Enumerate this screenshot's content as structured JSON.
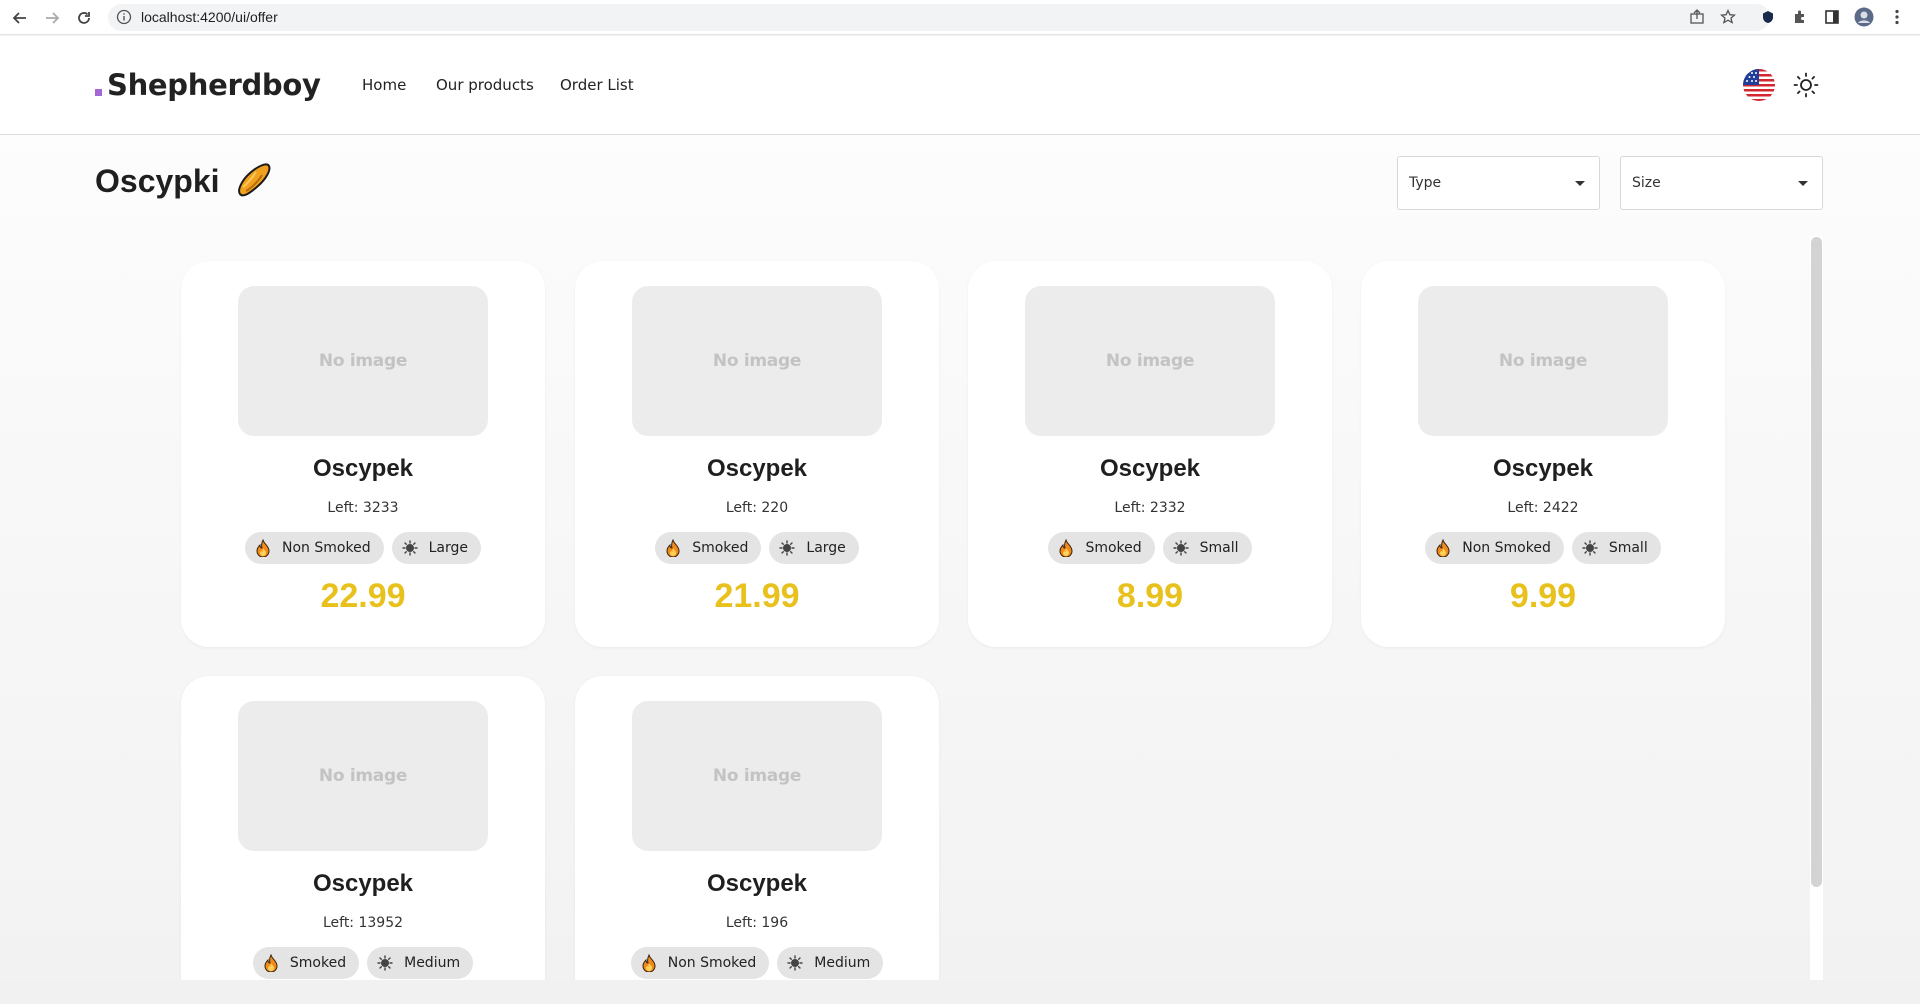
{
  "browser": {
    "url": "localhost:4200/ui/offer"
  },
  "header": {
    "brand": "Shepherdboy",
    "nav": [
      "Home",
      "Our products",
      "Order List"
    ]
  },
  "page": {
    "title": "Oscypki"
  },
  "filters": {
    "type_label": "Type",
    "size_label": "Size"
  },
  "products": [
    {
      "image_placeholder": "No image",
      "name": "Oscypek",
      "left": "Left: 3233",
      "smoke": "Non Smoked",
      "size": "Large",
      "price": "22.99"
    },
    {
      "image_placeholder": "No image",
      "name": "Oscypek",
      "left": "Left: 220",
      "smoke": "Smoked",
      "size": "Large",
      "price": "21.99"
    },
    {
      "image_placeholder": "No image",
      "name": "Oscypek",
      "left": "Left: 2332",
      "smoke": "Smoked",
      "size": "Small",
      "price": "8.99"
    },
    {
      "image_placeholder": "No image",
      "name": "Oscypek",
      "left": "Left: 2422",
      "smoke": "Non Smoked",
      "size": "Small",
      "price": "9.99"
    },
    {
      "image_placeholder": "No image",
      "name": "Oscypek",
      "left": "Left: 13952",
      "smoke": "Smoked",
      "size": "Medium",
      "price": ""
    },
    {
      "image_placeholder": "No image",
      "name": "Oscypek",
      "left": "Left: 196",
      "smoke": "Non Smoked",
      "size": "Medium",
      "price": ""
    }
  ],
  "colors": {
    "price": "#e8c11c",
    "brand_dot": "#a667d6",
    "chip_bg": "#e4e4e4"
  },
  "icons": {
    "smoke_chip": "fire-icon",
    "size_chip": "size-icon",
    "theme": "sun-icon",
    "language": "us-flag-icon"
  }
}
